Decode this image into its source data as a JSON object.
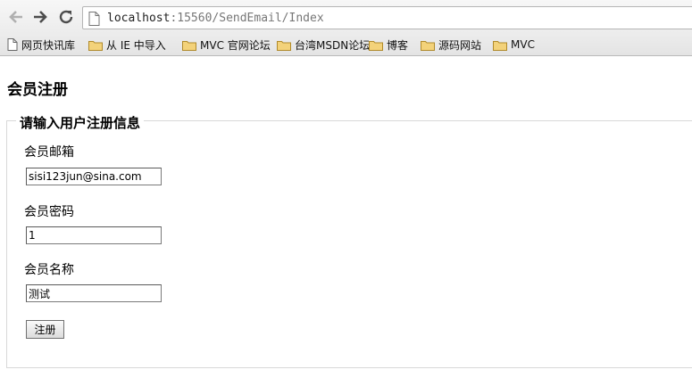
{
  "browser": {
    "nav": {
      "back_icon": "arrow-left-icon",
      "forward_icon": "arrow-right-icon",
      "reload_icon": "reload-icon"
    },
    "address": {
      "host": "localhost",
      "rest": ":15560/SendEmail/Index"
    },
    "bookmarks": [
      {
        "label": "网页快讯库",
        "icon": "page-icon"
      },
      {
        "label": "从 IE 中导入",
        "icon": "folder-icon"
      },
      {
        "label": "MVC 官网论坛",
        "icon": "folder-icon"
      },
      {
        "label": "台湾MSDN论坛",
        "icon": "folder-icon"
      },
      {
        "label": "博客",
        "icon": "folder-icon"
      },
      {
        "label": "源码网站",
        "icon": "folder-icon"
      },
      {
        "label": "MVC",
        "icon": "folder-icon"
      }
    ]
  },
  "page": {
    "title": "会员注册",
    "form": {
      "legend": "请输入用户注册信息",
      "email_label": "会员邮箱",
      "email_value": "sisi123jun@sina.com",
      "password_label": "会员密码",
      "password_value": "1",
      "name_label": "会员名称",
      "name_value": "测试",
      "submit_label": "注册"
    }
  },
  "colors": {
    "folder": "#e8c15a",
    "nav_icon": "#5a5a5a"
  }
}
